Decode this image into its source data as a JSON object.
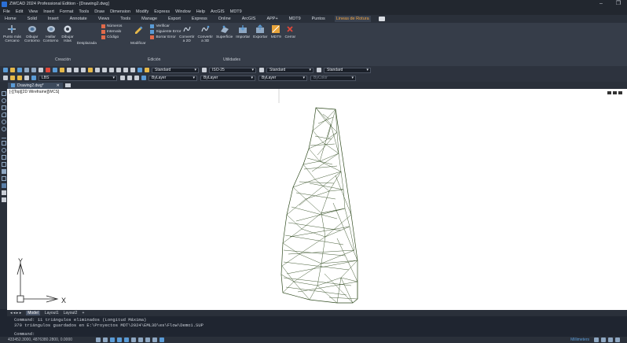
{
  "window": {
    "title": "ZWCAD 2024 Professional Edition - [Drawing2.dwg]",
    "minimize": "–",
    "restore": "❐"
  },
  "menu": [
    "File",
    "Edit",
    "View",
    "Insert",
    "Format",
    "Tools",
    "Draw",
    "Dimension",
    "Modify",
    "Express",
    "Window",
    "Help",
    "ArcGIS",
    "MDT9"
  ],
  "ribbon_tabs": [
    "Home",
    "Solid",
    "Insert",
    "Annotate",
    "Views",
    "Tools",
    "Manage",
    "Export",
    "Express",
    "Online",
    "ArcGIS",
    "APP+",
    "MDT9",
    "Puntos",
    "Lineas de Rotura"
  ],
  "ribbon_active_tab": "Lineas de Rotura",
  "ribbon": {
    "creacion": {
      "label": "Creación",
      "buttons": [
        {
          "label": "Punto más\nCercano",
          "icon": "point-icon"
        },
        {
          "label": "Dibujar\nContorno",
          "icon": "contour-icon"
        },
        {
          "label": "Hallar\nContorno",
          "icon": "find-contour-icon"
        },
        {
          "label": "Dibujar\nIslas",
          "icon": "islands-icon"
        }
      ],
      "small": [
        {
          "label": "Números",
          "icon": "numbers-icon"
        },
        {
          "label": "Intervalo",
          "icon": "interval-icon"
        },
        {
          "label": "Código",
          "icon": "code-icon"
        }
      ],
      "desplazada": "Desplazada"
    },
    "edicion": {
      "label": "Edición",
      "verificar": "Verificar",
      "siguiente": "Siguiente Error",
      "borrar": "Borrar Error",
      "modificar": "Modificar"
    },
    "utilidades": {
      "label": "Utilidades",
      "buttons": [
        {
          "label": "Convertir\na 2D",
          "icon": "convert-2d-icon"
        },
        {
          "label": "Convertir\na 3D",
          "icon": "convert-3d-icon"
        },
        {
          "label": "Superficie",
          "icon": "surface-icon"
        },
        {
          "label": "Importar",
          "icon": "import-icon"
        },
        {
          "label": "Exportar",
          "icon": "export-icon"
        },
        {
          "label": "MDT9",
          "icon": "mdt9-icon"
        },
        {
          "label": "Cerrar",
          "icon": "close-icon"
        }
      ]
    }
  },
  "toolbar": {
    "text_style": "Standard",
    "dim_style": "ISO-25",
    "table_style": "Standard",
    "mleader_style": "Standard",
    "layer": "LBS",
    "color": "ByLayer",
    "linetype": "ByLayer",
    "lineweight": "ByLayer",
    "plotstyle": "ByColor"
  },
  "doc_tab": {
    "label": "Drawing2.dwg*",
    "close": "✕"
  },
  "viewport_label": "[-][Top][2D Wireframe][WCS]",
  "ucs": {
    "x": "X",
    "y": "Y"
  },
  "layout_tabs": [
    "Model",
    "Layout1",
    "Layout2",
    "+"
  ],
  "command_history": [
    "Command: 11 triángulos eliminados (Longitud Máxima)",
    "370 triángulos guardados en E:\\Proyectos MDT\\2024\\EML3D\\es\\Flow\\Demo1.SUP"
  ],
  "command_prompt": "Command:",
  "status": {
    "coords": "433452.3000, 4876380.2800, 0.0000",
    "right_text": "Millimeters"
  },
  "colors": {
    "accent": "#f0a444",
    "canvas": "#ffffff",
    "mesh": "#2f4a1e"
  }
}
